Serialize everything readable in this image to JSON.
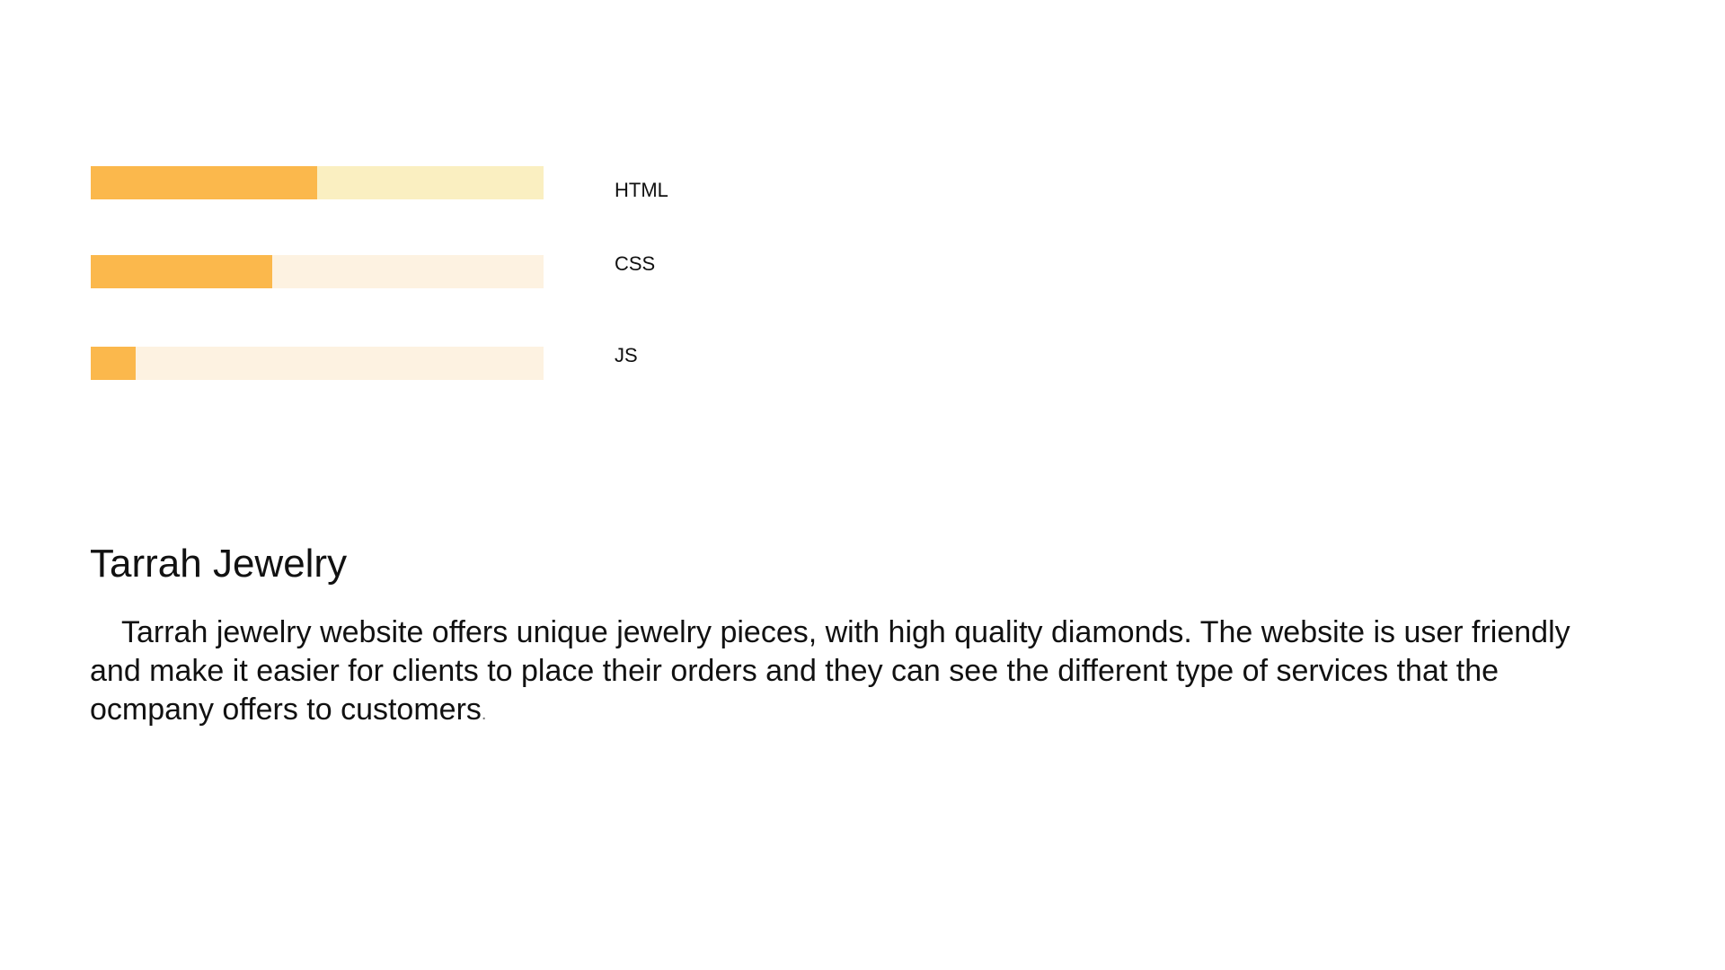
{
  "colors": {
    "fill": "#fbb84c",
    "track_light_yellow": "#faefc1",
    "track_light_cream": "#fdf2e1",
    "text": "#111111"
  },
  "skills": [
    {
      "label": "HTML",
      "level_percent": 50,
      "track_color": "#faefc1"
    },
    {
      "label": "CSS",
      "level_percent": 40,
      "track_color": "#fdf2e1"
    },
    {
      "label": "JS",
      "level_percent": 10,
      "track_color": "#fdf2e1"
    }
  ],
  "project": {
    "title": "Tarrah Jewelry",
    "description": "Tarrah jewelry website offers unique jewelry pieces, with high quality diamonds. The website is user friendly and make it easier for clients to place their orders and they can see the different type of services that the ocmpany offers to customers",
    "description_end": "."
  }
}
